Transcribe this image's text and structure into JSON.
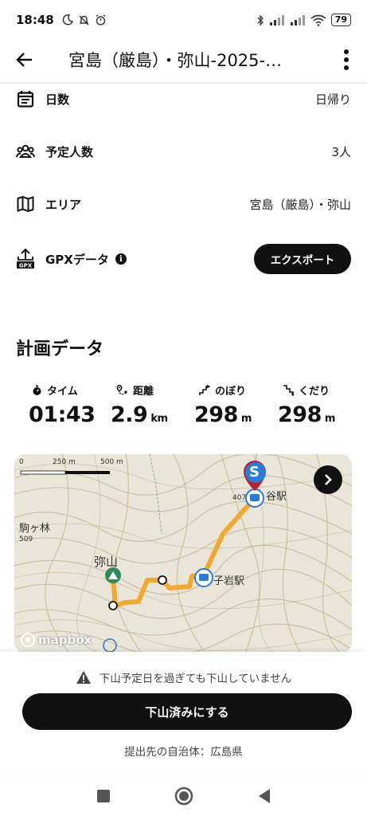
{
  "status_bar": {
    "time": "18:48",
    "battery": "79"
  },
  "app_bar": {
    "title": "宮島（厳島）・弥山-2025-…"
  },
  "info": {
    "days_label": "日数",
    "days_value": "日帰り",
    "people_label": "予定人数",
    "people_value": "3人",
    "area_label": "エリア",
    "area_value": "宮島（厳島）・弥山",
    "gpx_label": "GPXデータ",
    "gpx_info": "i",
    "export_label": "エクスポート"
  },
  "plan": {
    "title": "計画データ",
    "stats": [
      {
        "label": "タイム",
        "value": "01:43",
        "unit": "",
        "icon": "stopwatch-icon"
      },
      {
        "label": "距離",
        "value": "2.9",
        "unit": "km",
        "icon": "distance-pin-icon"
      },
      {
        "label": "のぼり",
        "value": "298",
        "unit": "m",
        "icon": "ascent-icon"
      },
      {
        "label": "くだり",
        "value": "298",
        "unit": "m",
        "icon": "descent-icon"
      }
    ]
  },
  "map": {
    "scale_0": "0",
    "scale_250": "250 m",
    "scale_500": "500 m",
    "label_misen": "弥山",
    "label_komagabayashi": "駒ヶ林",
    "label_shishiiwa": "子岩駅",
    "label_kanzaki": "谷駅",
    "label_elev_1": "407",
    "label_elev_2": "509",
    "start_marker": "S",
    "logo": "mapbox",
    "route_color": "#f0a92e"
  },
  "bottom": {
    "warning": "下山予定日を過ぎても下山していません",
    "button": "下山済みにする",
    "submit_note": "提出先の自治体：広島県"
  }
}
